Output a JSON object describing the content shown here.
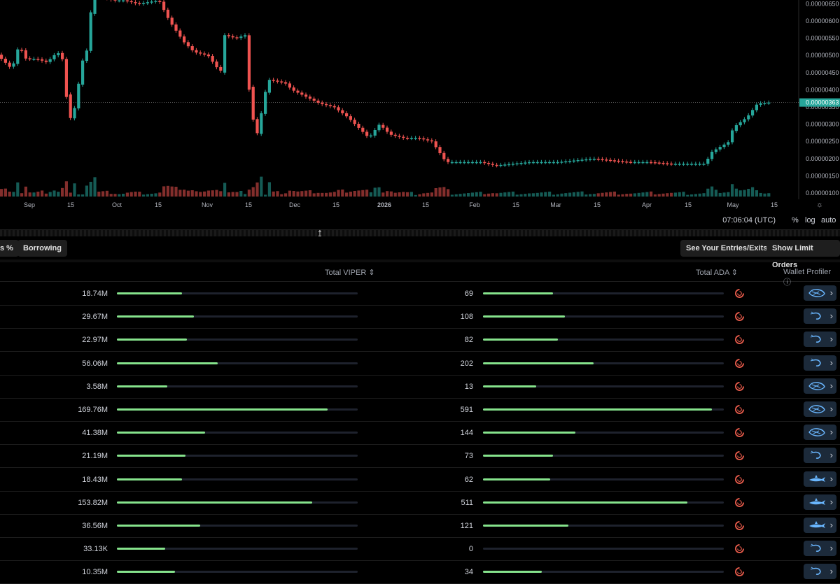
{
  "chart": {
    "price_labels": [
      "0.00000650",
      "0.00000600",
      "0.00000550",
      "0.00000500",
      "0.00000450",
      "0.00000400",
      "0.00000350",
      "0.00000300",
      "0.00000250",
      "0.00000200",
      "0.00000150",
      "0.00000100"
    ],
    "current_price": "0.00000363",
    "date_labels": [
      "Sep",
      "15",
      "Oct",
      "15",
      "Nov",
      "15",
      "Dec",
      "15",
      "2026",
      "15",
      "Feb",
      "15",
      "Mar",
      "15",
      "Apr",
      "15",
      "May",
      "15"
    ],
    "clock": "07:06:04 (UTC)",
    "controls": {
      "percent": "%",
      "log": "log",
      "auto": "auto"
    },
    "colors": {
      "up": "#26a69a",
      "down": "#ef5350",
      "price_tag": "#26a69a"
    }
  },
  "toolbar": {
    "left_partial": "s %",
    "borrowing": "Borrowing",
    "entries_exits": "See Your Entries/Exits",
    "limit_orders": "Show Limit Orders"
  },
  "table": {
    "headers": {
      "total_token": "Total VIPER",
      "total_ada": "Total ADA",
      "wallet_profiler": "Wallet Profiler"
    },
    "rows": [
      {
        "viper": "18.74M",
        "viper_frac": 0.27,
        "ada": "69",
        "ada_frac": 0.29,
        "profile_icon": "whale-icon"
      },
      {
        "viper": "29.67M",
        "viper_frac": 0.32,
        "ada": "108",
        "ada_frac": 0.34,
        "profile_icon": "shrimp-icon"
      },
      {
        "viper": "22.97M",
        "viper_frac": 0.29,
        "ada": "82",
        "ada_frac": 0.31,
        "profile_icon": "shrimp-icon"
      },
      {
        "viper": "56.06M",
        "viper_frac": 0.42,
        "ada": "202",
        "ada_frac": 0.46,
        "profile_icon": "shrimp-icon"
      },
      {
        "viper": "3.58M",
        "viper_frac": 0.21,
        "ada": "13",
        "ada_frac": 0.22,
        "profile_icon": "whale-icon"
      },
      {
        "viper": "169.76M",
        "viper_frac": 0.875,
        "ada": "591",
        "ada_frac": 0.95,
        "profile_icon": "whale-icon"
      },
      {
        "viper": "41.38M",
        "viper_frac": 0.365,
        "ada": "144",
        "ada_frac": 0.385,
        "profile_icon": "whale-icon"
      },
      {
        "viper": "21.19M",
        "viper_frac": 0.285,
        "ada": "73",
        "ada_frac": 0.29,
        "profile_icon": "shrimp-icon"
      },
      {
        "viper": "18.43M",
        "viper_frac": 0.27,
        "ada": "62",
        "ada_frac": 0.28,
        "profile_icon": "shark-icon"
      },
      {
        "viper": "153.82M",
        "viper_frac": 0.81,
        "ada": "511",
        "ada_frac": 0.85,
        "profile_icon": "shark-icon"
      },
      {
        "viper": "36.56M",
        "viper_frac": 0.345,
        "ada": "121",
        "ada_frac": 0.355,
        "profile_icon": "shark-icon"
      },
      {
        "viper": "33.13K",
        "viper_frac": 0.2,
        "ada": "0",
        "ada_frac": 0.0,
        "profile_icon": "shrimp-icon"
      },
      {
        "viper": "10.35M",
        "viper_frac": 0.24,
        "ada": "34",
        "ada_frac": 0.245,
        "profile_icon": "shrimp-icon"
      }
    ]
  },
  "colors": {
    "bar_fill": "#86e38c",
    "spinner": "#e55a4a",
    "profile_bg": "#1c2a3a"
  }
}
